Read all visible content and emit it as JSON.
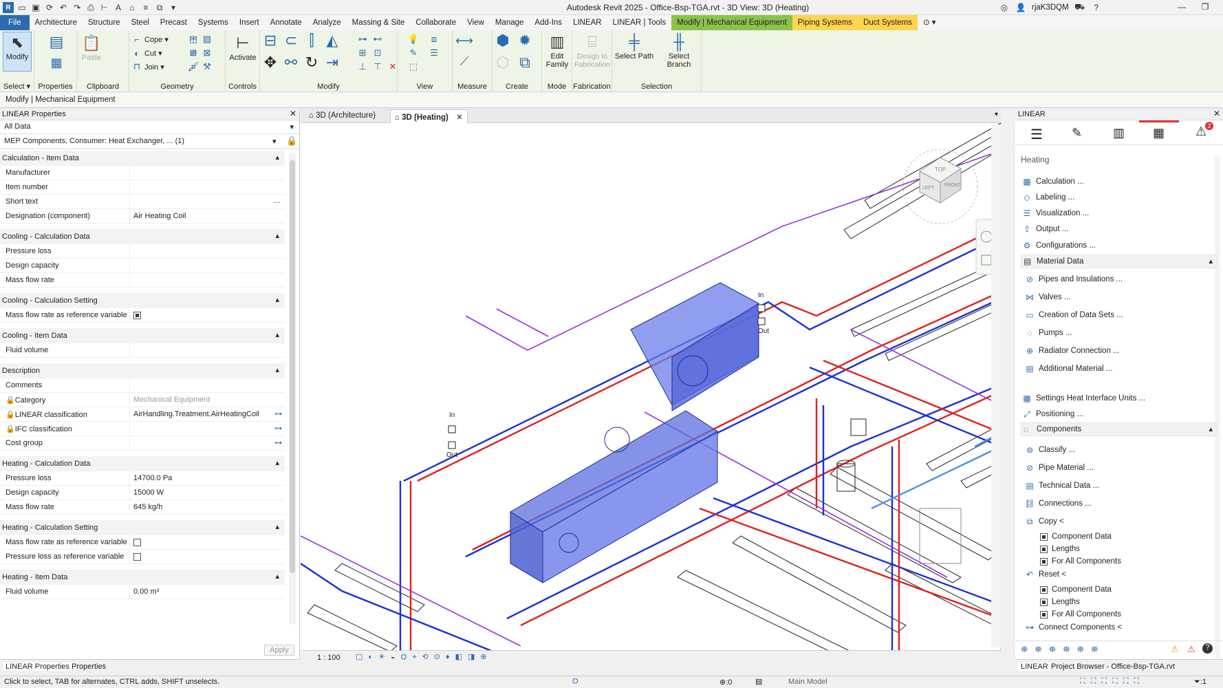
{
  "app_title": "Autodesk Revit 2025 - Office-Bsp-TGA.rvt - 3D View: 3D (Heating)",
  "user": "rjaK3DQM",
  "menu_tabs": [
    "File",
    "Architecture",
    "Structure",
    "Steel",
    "Precast",
    "Systems",
    "Insert",
    "Annotate",
    "Analyze",
    "Massing & Site",
    "Collaborate",
    "View",
    "Manage",
    "Add-Ins",
    "LINEAR",
    "LINEAR | Tools",
    "Modify | Mechanical Equipment",
    "Piping Systems",
    "Duct Systems"
  ],
  "ribbon": {
    "modify": "Modify",
    "properties": "Properties",
    "paste": "Paste",
    "cope": "Cope",
    "cut": "Cut",
    "join": "Join",
    "activate": "Activate",
    "edit_family": "Edit Family",
    "design_to_fabrication": "Design to Fabrication",
    "select_path": "Select Path",
    "select_branch": "Select Branch",
    "panels": {
      "select": "Select",
      "properties": "Properties",
      "clipboard": "Clipboard",
      "geometry": "Geometry",
      "controls": "Controls",
      "modify": "Modify",
      "view": "View",
      "measure": "Measure",
      "create": "Create",
      "mode": "Mode",
      "fabrication": "Fabrication",
      "selection": "Selection"
    }
  },
  "context_bar": "Modify | Mechanical Equipment",
  "left_panel": {
    "title": "LINEAR Properties",
    "filter": "All Data",
    "type_selector": "MEP Components, Consumer: Heat Exchanger, ... (1)",
    "groups": [
      {
        "name": "Calculation - Item Data",
        "rows": [
          [
            "Manufacturer",
            ""
          ],
          [
            "Item number",
            ""
          ],
          [
            "Short text",
            ""
          ],
          [
            "Designation (component)",
            "Air Heating Coil"
          ]
        ]
      },
      {
        "name": "Cooling - Calculation Data",
        "rows": [
          [
            "Pressure loss",
            ""
          ],
          [
            "Design capacity",
            ""
          ],
          [
            "Mass flow rate",
            ""
          ]
        ]
      },
      {
        "name": "Cooling - Calculation Setting",
        "rows": [
          [
            "Mass flow rate as reference variable",
            ""
          ]
        ]
      },
      {
        "name": "Cooling - Item Data",
        "rows": [
          [
            "Fluid volume",
            ""
          ]
        ]
      },
      {
        "name": "Description",
        "rows": [
          [
            "Comments",
            ""
          ],
          [
            "Category",
            "Mechanical Equipment"
          ],
          [
            "LINEAR classification",
            "AirHandling.Treatment.AirHeatingCoil"
          ],
          [
            "IFC classification",
            ""
          ],
          [
            "Cost group",
            ""
          ]
        ]
      },
      {
        "name": "Heating - Calculation Data",
        "rows": [
          [
            "Pressure loss",
            "14700.0 Pa"
          ],
          [
            "Design capacity",
            "15000 W"
          ],
          [
            "Mass flow rate",
            "645 kg/h"
          ]
        ]
      },
      {
        "name": "Heating - Calculation Setting",
        "rows": [
          [
            "Mass flow rate as reference variable",
            ""
          ],
          [
            "Pressure loss as reference variable",
            ""
          ]
        ]
      },
      {
        "name": "Heating - Item Data",
        "rows": [
          [
            "Fluid volume",
            "0.00 m³"
          ]
        ]
      }
    ],
    "apply": "Apply",
    "footer_tabs": [
      "LINEAR Properties",
      "Properties"
    ]
  },
  "view": {
    "tabs": [
      "3D (Architecture)",
      "3D (Heating)"
    ],
    "scale": "1 : 100",
    "labels": {
      "in1": "In",
      "out1": "Out",
      "in2": "In",
      "out2": "Out"
    },
    "cube": {
      "top": "TOP",
      "left": "LEFT",
      "front": "FRONT"
    }
  },
  "right_panel": {
    "title": "LINEAR",
    "section": "Heating",
    "items": [
      "Calculation ...",
      "Labeling ...",
      "Visualization ...",
      "Output ...",
      "Configurations ..."
    ],
    "material_data": "Material Data",
    "material_items": [
      "Pipes and Insulations ...",
      "Valves ...",
      "Creation of Data Sets ...",
      "Pumps ...",
      "Radiator Connection ...",
      "Additional Material ..."
    ],
    "settings": [
      "Settings Heat Interface Units ...",
      "Positioning ..."
    ],
    "components": "Components",
    "component_items": [
      "Classify ...",
      "Pipe Material ...",
      "Technical Data ...",
      "Connections ..."
    ],
    "copy": "Copy <",
    "copy_items": [
      "Component Data",
      "Lengths",
      "For All Components"
    ],
    "reset": "Reset <",
    "reset_items": [
      "Component Data",
      "Lengths",
      "For All Components"
    ],
    "connect": "Connect Components <",
    "badge": "2",
    "footer_tabs": [
      "LINEAR",
      "Project Browser - Office-Bsp-TGA.rvt"
    ]
  },
  "status": {
    "hint": "Click to select, TAB for alternates, CTRL adds, SHIFT unselects.",
    "zero": ":0",
    "model": "Main Model",
    "filter": ":1"
  },
  "colors": {
    "ribbon": "#eef5e6",
    "ctx": "#8bc34a",
    "heat_red": "#e02020",
    "heat_blue": "#1a2fd8",
    "purple": "#9b30d9",
    "equipment": "#5b6fe0"
  }
}
